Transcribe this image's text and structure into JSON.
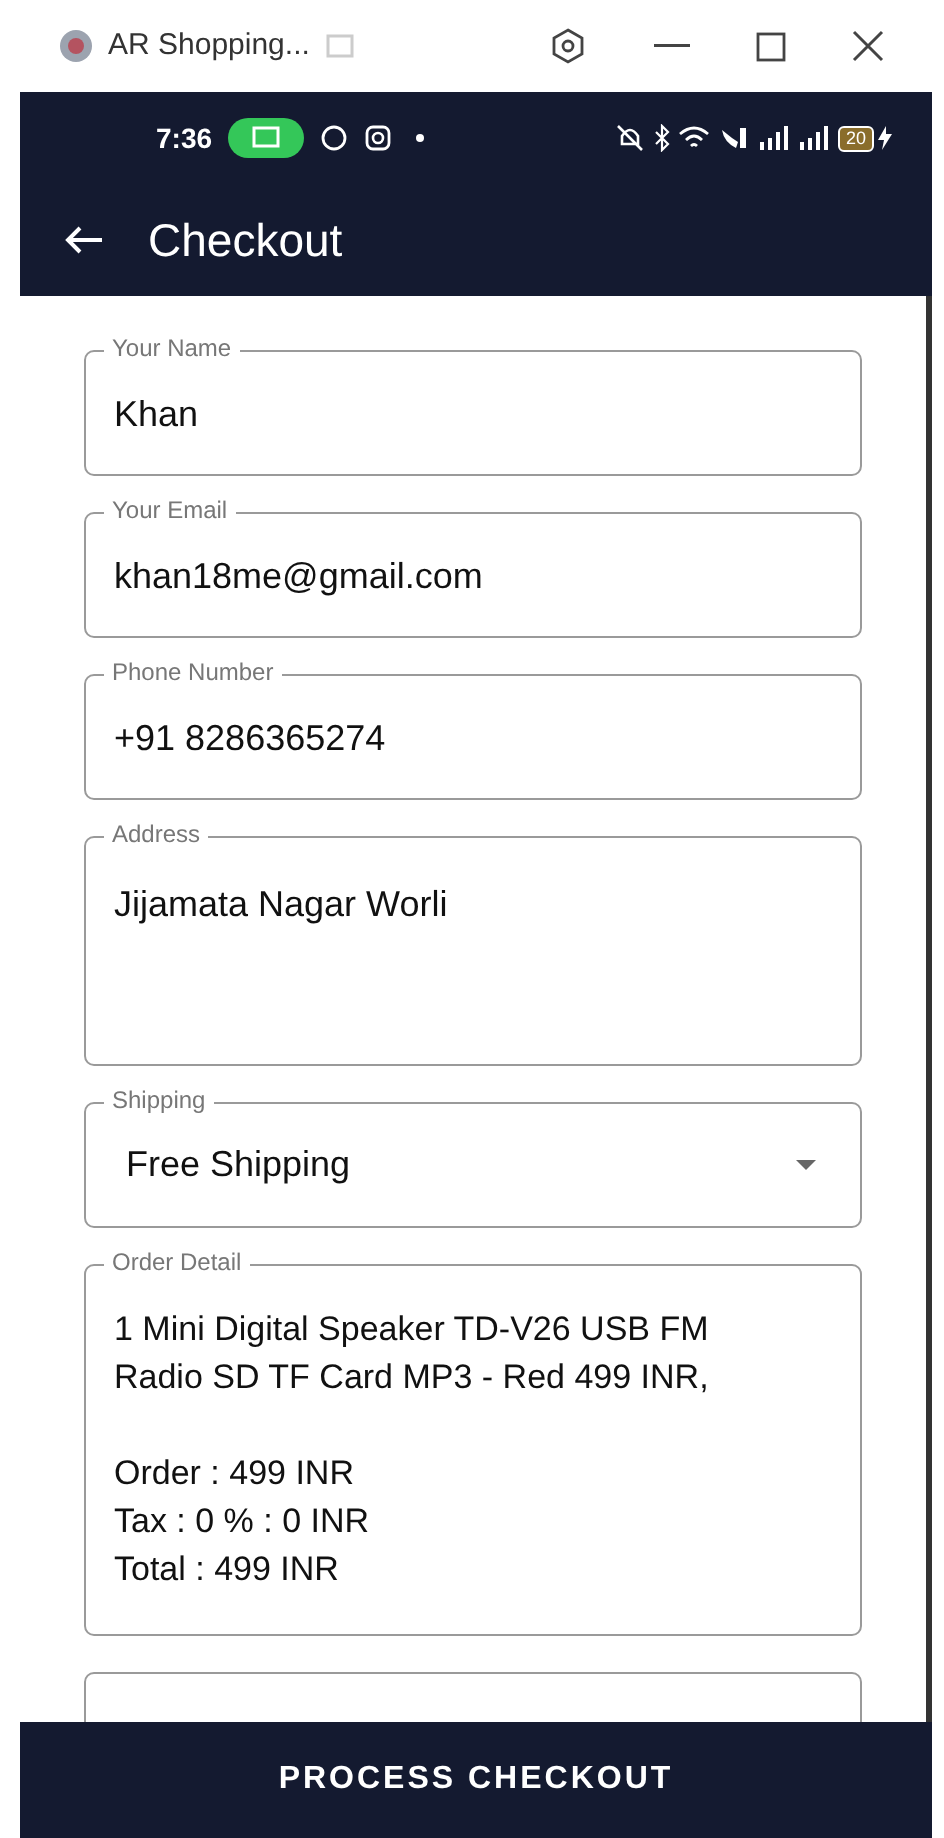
{
  "window": {
    "title": "AR Shopping..."
  },
  "status_bar": {
    "time": "7:36",
    "battery": "20"
  },
  "app_bar": {
    "title": "Checkout"
  },
  "fields": [
    {
      "kind": "text",
      "label": "Your Name",
      "value": "Khan"
    },
    {
      "kind": "text",
      "label": "Your Email",
      "value": "khan18me@gmail.com"
    },
    {
      "kind": "text",
      "label": "Phone Number",
      "value": "+91 8286365274"
    },
    {
      "kind": "multiline",
      "label": "Address",
      "value": "Jijamata Nagar Worli"
    },
    {
      "kind": "dropdown",
      "label": "Shipping",
      "value": "Free Shipping"
    },
    {
      "kind": "detail",
      "label": "Order Detail",
      "item_lines": [
        "1 Mini Digital Speaker TD-V26 USB FM",
        "Radio SD TF Card MP3 - Red 499 INR,"
      ],
      "summary_lines": [
        "Order : 499 INR",
        "Tax : 0 % : 0 INR",
        "Total : 499 INR"
      ]
    },
    {
      "kind": "empty"
    }
  ],
  "button": {
    "label": "PROCESS CHECKOUT"
  }
}
